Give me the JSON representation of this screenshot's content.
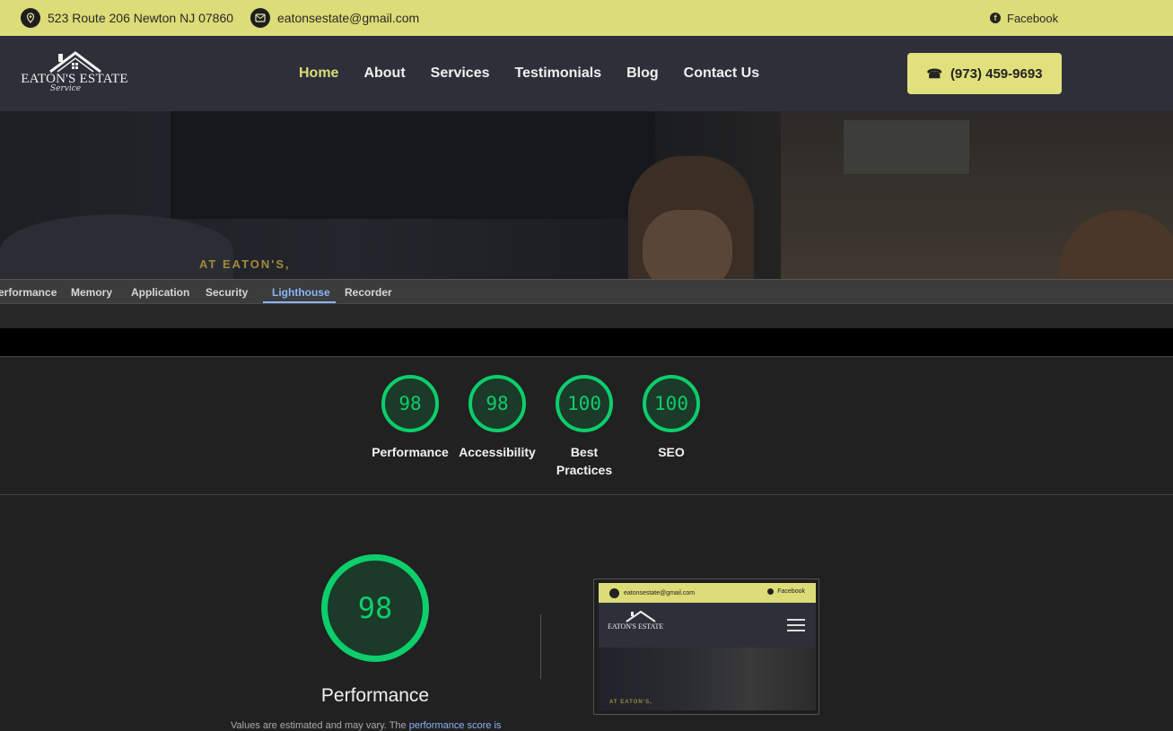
{
  "topbar": {
    "address": "523 Route 206 Newton NJ 07860",
    "email": "eatonsestate@gmail.com",
    "facebook": "Facebook",
    "colors": {
      "bar": "#dcdc78",
      "icon_bg": "#1e1e1e"
    }
  },
  "logo": {
    "name": "EATON'S ESTATE",
    "sub": "Service"
  },
  "nav": {
    "items": [
      "Home",
      "About",
      "Services",
      "Testimonials",
      "Blog",
      "Contact Us"
    ],
    "active": "Home",
    "phone": "(973) 459-9693",
    "colors": {
      "accent": "#dcdc78",
      "bg": "#2d3038"
    }
  },
  "hero": {
    "tagline": "AT EATON'S,"
  },
  "devtools": {
    "tabs": [
      "erformance",
      "Memory",
      "Application",
      "Security",
      "Lighthouse",
      "Recorder"
    ],
    "active_tab": "Lighthouse"
  },
  "lighthouse": {
    "scores": [
      {
        "label": "Performance",
        "value": "98"
      },
      {
        "label": "Accessibility",
        "value": "98"
      },
      {
        "label": "Best Practices",
        "value": "100"
      },
      {
        "label": "SEO",
        "value": "100"
      }
    ],
    "performance": {
      "score": "98",
      "title": "Performance",
      "note_prefix": "Values are estimated and may vary. The ",
      "note_link": "performance score is"
    },
    "colors": {
      "pass": "#0cce6b",
      "pass_bg": "#1b3a29"
    }
  },
  "thumbnail": {
    "email": "eatonsestate@gmail.com",
    "facebook": "Facebook",
    "name": "EATON'S ESTATE",
    "tagline": "AT EATON'S,"
  }
}
